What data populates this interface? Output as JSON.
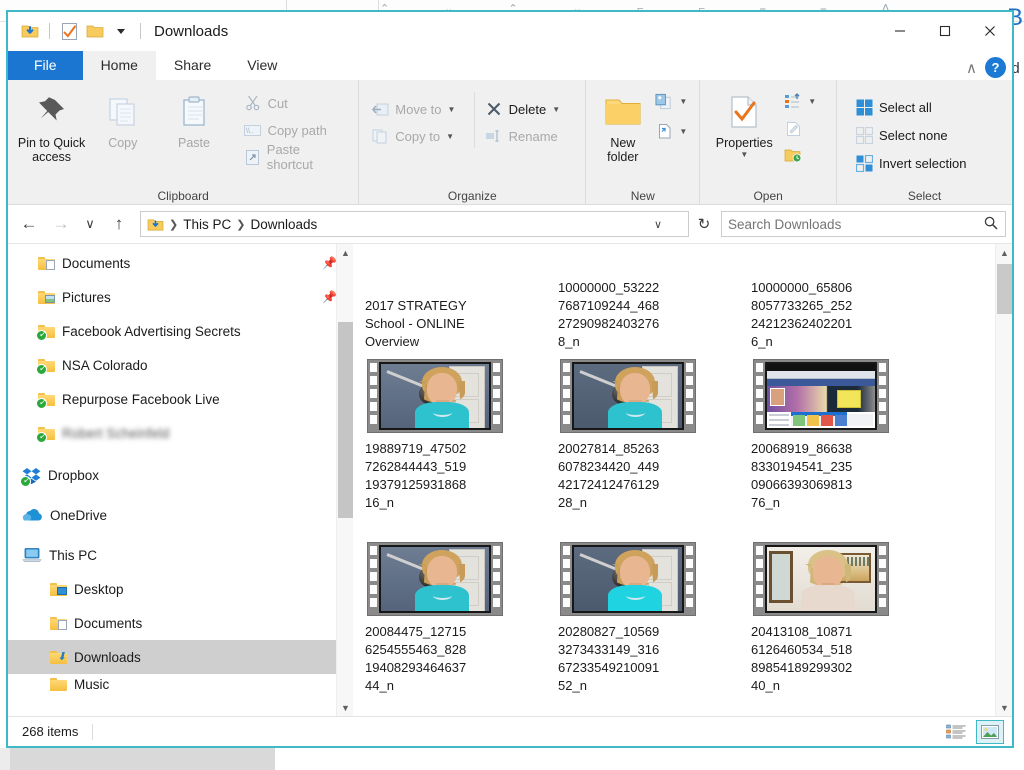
{
  "window": {
    "title": "Downloads",
    "quick_access": [
      "downloads-folder-icon",
      "properties-check-icon",
      "new-folder-icon",
      "customize-caret-icon"
    ],
    "controls": {
      "minimize": "─",
      "maximize": "☐",
      "close": "✕"
    }
  },
  "tabs": [
    {
      "label": "File",
      "id": "file"
    },
    {
      "label": "Home",
      "id": "home"
    },
    {
      "label": "Share",
      "id": "share"
    },
    {
      "label": "View",
      "id": "view"
    }
  ],
  "tab_help": {
    "collapse": "∧",
    "help": "?"
  },
  "ribbon": {
    "groups": [
      {
        "label": "Clipboard",
        "big_buttons": [
          {
            "label": "Pin to Quick access",
            "icon": "pin-icon",
            "disabled": false
          },
          {
            "label": "Copy",
            "icon": "copy-icon",
            "disabled": true
          },
          {
            "label": "Paste",
            "icon": "paste-icon",
            "disabled": false
          }
        ],
        "small_buttons": [
          {
            "label": "Cut",
            "icon": "scissors-icon",
            "disabled": true
          },
          {
            "label": "Copy path",
            "icon": "copy-path-icon",
            "disabled": true
          },
          {
            "label": "Paste shortcut",
            "icon": "paste-shortcut-icon",
            "disabled": true
          }
        ]
      },
      {
        "label": "Organize",
        "small_buttons": [
          {
            "label": "Move to",
            "icon": "move-to-icon",
            "disabled": true,
            "caret": true
          },
          {
            "label": "Copy to",
            "icon": "copy-to-icon",
            "disabled": true,
            "caret": true
          },
          {
            "label": "Delete",
            "icon": "delete-x-icon",
            "disabled": false,
            "caret": true
          },
          {
            "label": "Rename",
            "icon": "rename-icon",
            "disabled": true,
            "caret": false
          }
        ]
      },
      {
        "label": "New",
        "big_buttons": [
          {
            "label": "New folder",
            "icon": "new-folder-icon",
            "disabled": false
          }
        ],
        "small_buttons": [
          {
            "label": "",
            "icon": "new-item-icon",
            "disabled": false,
            "caret": true
          },
          {
            "label": "",
            "icon": "easy-access-icon",
            "disabled": false,
            "caret": true
          }
        ]
      },
      {
        "label": "Open",
        "big_buttons": [
          {
            "label": "Properties",
            "icon": "properties-icon",
            "disabled": false,
            "caret": true
          }
        ],
        "small_buttons": [
          {
            "label": "",
            "icon": "open-with-icon",
            "disabled": false,
            "caret": true
          },
          {
            "label": "",
            "icon": "edit-icon",
            "disabled": true,
            "caret": false
          },
          {
            "label": "",
            "icon": "history-icon",
            "disabled": false,
            "caret": false
          }
        ]
      },
      {
        "label": "Select",
        "small_buttons": [
          {
            "label": "Select all",
            "icon": "select-all-icon",
            "disabled": false
          },
          {
            "label": "Select none",
            "icon": "select-none-icon",
            "disabled": true
          },
          {
            "label": "Invert selection",
            "icon": "invert-selection-icon",
            "disabled": false
          }
        ]
      }
    ]
  },
  "addressbar": {
    "back": "←",
    "forward": "→",
    "recent": "∨",
    "up": "↑",
    "breadcrumbs": [
      "This PC",
      "Downloads"
    ],
    "breadcrumb_icon": "downloads-folder-icon",
    "dropdown_caret": "∨",
    "refresh": "↻",
    "search_placeholder": "Search Downloads",
    "search_value": "",
    "search_icon": "search-icon"
  },
  "sidebar": {
    "items": [
      {
        "label": "Documents",
        "icon": "folder-documents-icon",
        "indent": 1,
        "pinned": true,
        "selected": false,
        "blurred": false
      },
      {
        "label": "Pictures",
        "icon": "folder-pictures-icon",
        "indent": 1,
        "pinned": true,
        "selected": false,
        "blurred": false
      },
      {
        "label": "Facebook Advertising Secrets",
        "icon": "folder-synced-icon",
        "indent": 1,
        "pinned": false,
        "selected": false,
        "blurred": false
      },
      {
        "label": "NSA Colorado",
        "icon": "folder-synced-icon",
        "indent": 1,
        "pinned": false,
        "selected": false,
        "blurred": false
      },
      {
        "label": "Repurpose Facebook Live",
        "icon": "folder-synced-icon",
        "indent": 1,
        "pinned": false,
        "selected": false,
        "blurred": false
      },
      {
        "label": "Robert Scheinfeld",
        "icon": "folder-synced-icon",
        "indent": 1,
        "pinned": false,
        "selected": false,
        "blurred": true
      },
      {
        "label": "Dropbox",
        "icon": "dropbox-icon",
        "indent": 0,
        "pinned": false,
        "selected": false,
        "blurred": false
      },
      {
        "label": "OneDrive",
        "icon": "onedrive-icon",
        "indent": 0,
        "pinned": false,
        "selected": false,
        "blurred": false
      },
      {
        "label": "This PC",
        "icon": "this-pc-icon",
        "indent": 0,
        "pinned": false,
        "selected": false,
        "blurred": false
      },
      {
        "label": "Desktop",
        "icon": "folder-desktop-icon",
        "indent": 1,
        "pinned": false,
        "selected": false,
        "blurred": false
      },
      {
        "label": "Documents",
        "icon": "folder-documents-icon",
        "indent": 1,
        "pinned": false,
        "selected": false,
        "blurred": false
      },
      {
        "label": "Downloads",
        "icon": "folder-downloads-icon",
        "indent": 1,
        "pinned": false,
        "selected": true,
        "blurred": false
      },
      {
        "label": "Music",
        "icon": "folder-music-icon",
        "indent": 1,
        "pinned": false,
        "selected": false,
        "blurred": false
      }
    ]
  },
  "files": [
    {
      "name": "2017 STRATEGY School - ONLINE Overview",
      "thumb": "none",
      "kind": "text-only"
    },
    {
      "name": "10000000_532227687109244_4682729098240327688_n",
      "thumb": "none",
      "kind": "text-only"
    },
    {
      "name": "10000000_658068057733265_2522421236240220166_n",
      "thumb": "none",
      "kind": "text-only"
    },
    {
      "name": "19889719_475027262844443_51919379125931868816_n",
      "thumb": "video-a",
      "kind": "video"
    },
    {
      "name": "20027814_852636078234420_44942172412476129 28_n",
      "thumb": "video-b",
      "kind": "video"
    },
    {
      "name": "20068919_866388330194541_23509066393069813 76_n",
      "thumb": "facebook-page",
      "kind": "video"
    },
    {
      "name": "20084475_127156254555463_82819408293464637 44_n",
      "thumb": "video-a",
      "kind": "video"
    },
    {
      "name": "20280827_105693273433149_31667233549210091 52_n",
      "thumb": "video-b",
      "kind": "video"
    },
    {
      "name": "20413108_108716126460534_51889854189299302 40_n",
      "thumb": "video-c",
      "kind": "video"
    }
  ],
  "file_labels": [
    [
      "2017 STRATEGY",
      "School - ONLINE",
      "Overview"
    ],
    [
      "10000000_53222",
      "7687109244_468",
      "27290982403276",
      "8_n"
    ],
    [
      "10000000_65806",
      "8057733265_252",
      "24212362402201",
      "6_n"
    ],
    [
      "19889719_47502",
      "7262844443_519",
      "19379125931868",
      "16_n"
    ],
    [
      "20027814_85263",
      "6078234420_449",
      "42172412476129",
      "28_n"
    ],
    [
      "20068919_86638",
      "8330194541_235",
      "09066393069813",
      "76_n"
    ],
    [
      "20084475_12715",
      "6254555463_828",
      "19408293464637",
      "44_n"
    ],
    [
      "20280827_10569",
      "3273433149_316",
      "67233549210091",
      "52_n"
    ],
    [
      "20413108_10871",
      "6126460534_518",
      "89854189299302",
      "40_n"
    ]
  ],
  "statusbar": {
    "item_count": "268 items",
    "view_buttons": [
      {
        "name": "details-view",
        "active": false
      },
      {
        "name": "large-icons-view",
        "active": true
      }
    ]
  },
  "colors": {
    "accent": "#1b76d2",
    "window_border": "#3fb8c8",
    "ribbon_bg": "#f0f0f0",
    "selected_row": "#cfcfcf",
    "folder_yellow": "#f5bf3f"
  }
}
